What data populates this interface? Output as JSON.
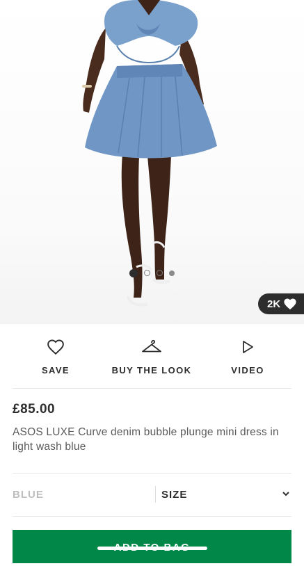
{
  "gallery": {
    "dots": [
      {
        "active": true
      },
      {
        "active": false
      },
      {
        "active": false
      },
      {
        "active": false,
        "small": true
      }
    ],
    "likes_count": "2K"
  },
  "actions": {
    "save_label": "SAVE",
    "buy_the_look_label": "BUY THE LOOK",
    "video_label": "VIDEO"
  },
  "product": {
    "price": "£85.00",
    "title": "ASOS LUXE Curve denim bubble plunge mini dress in light wash blue"
  },
  "selectors": {
    "colour": "BLUE",
    "size": "SIZE"
  },
  "cta": {
    "add_to_bag_label": "ADD TO BAG"
  },
  "colors": {
    "brand_green": "#018849",
    "text_dark": "#2d2d2d",
    "denim": "#6f96c4"
  }
}
